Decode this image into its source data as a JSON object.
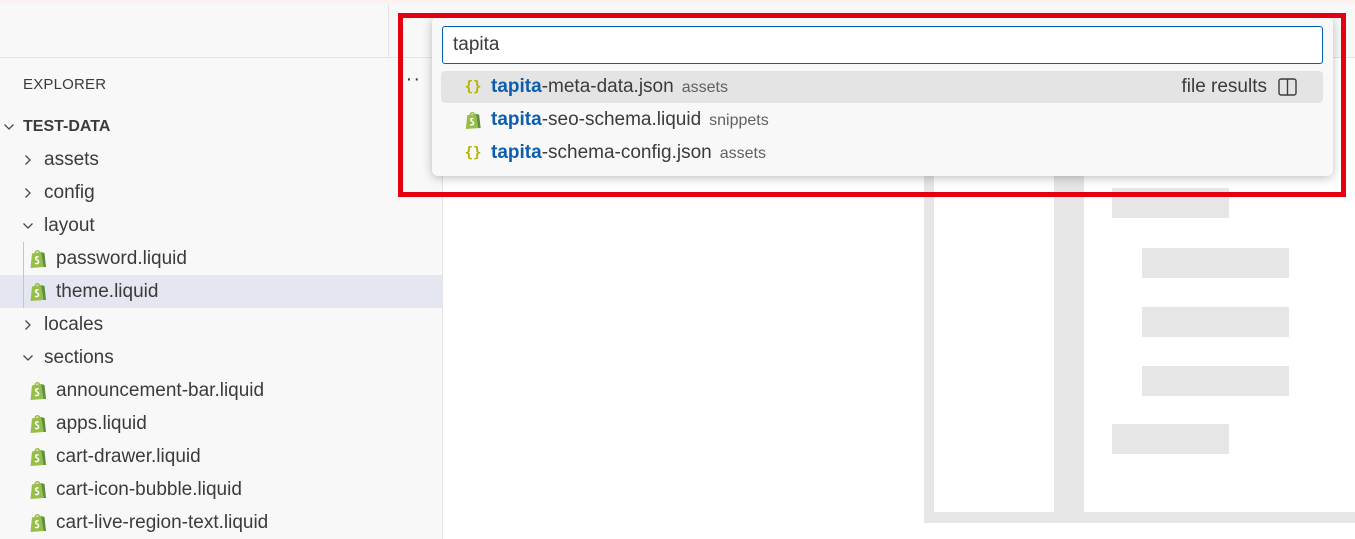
{
  "explorer": {
    "header": "EXPLORER",
    "more_label": "···",
    "root": "TEST-DATA",
    "items": [
      {
        "label": "assets",
        "kind": "folder",
        "expanded": false,
        "depth": 0
      },
      {
        "label": "config",
        "kind": "folder",
        "expanded": false,
        "depth": 0
      },
      {
        "label": "layout",
        "kind": "folder",
        "expanded": true,
        "depth": 0
      },
      {
        "label": "password.liquid",
        "kind": "liquid",
        "depth": 1
      },
      {
        "label": "theme.liquid",
        "kind": "liquid",
        "depth": 1,
        "selected": true
      },
      {
        "label": "locales",
        "kind": "folder",
        "expanded": false,
        "depth": 0
      },
      {
        "label": "sections",
        "kind": "folder",
        "expanded": true,
        "depth": 0
      },
      {
        "label": "announcement-bar.liquid",
        "kind": "liquid",
        "depth": 1
      },
      {
        "label": "apps.liquid",
        "kind": "liquid",
        "depth": 1
      },
      {
        "label": "cart-drawer.liquid",
        "kind": "liquid",
        "depth": 1
      },
      {
        "label": "cart-icon-bubble.liquid",
        "kind": "liquid",
        "depth": 1
      },
      {
        "label": "cart-live-region-text.liquid",
        "kind": "liquid",
        "depth": 1
      }
    ]
  },
  "quick_open": {
    "query": "tapita",
    "results": [
      {
        "match": "tapita",
        "rest": "-meta-data.json",
        "description": "assets",
        "icon": "json-braces-icon",
        "active": true
      },
      {
        "match": "tapita",
        "rest": "-seo-schema.liquid",
        "description": "snippets",
        "icon": "shopify-liquid-icon",
        "active": false
      },
      {
        "match": "tapita",
        "rest": "-schema-config.json",
        "description": "assets",
        "icon": "json-braces-icon",
        "active": false
      }
    ],
    "active_hint": "file results"
  },
  "colors": {
    "highlight_border": "#e3000f",
    "match_text": "#0e5ead",
    "input_border": "#005fb8",
    "shopify_green": "#95bf47",
    "json_yellow": "#b8b100"
  }
}
